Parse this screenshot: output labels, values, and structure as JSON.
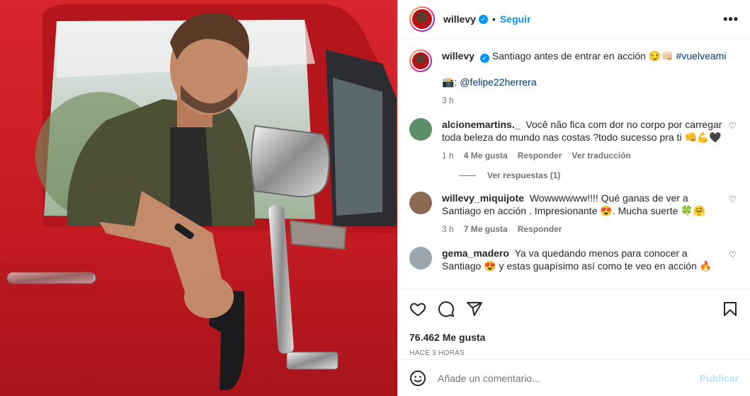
{
  "post": {
    "image_alt": "Hombre en una camioneta roja con pistola",
    "author": "willevy",
    "follow_label": "Seguir",
    "dot": "•"
  },
  "caption": {
    "author": "willevy",
    "text": "Santiago antes de entrar en acción 😏👊🏻",
    "hashtag": "#vuelveami",
    "credit_emoji": "📸:",
    "credit_mention": "@felipe22herrera",
    "time": "3 h"
  },
  "comments": [
    {
      "username": "alcionemartins._",
      "text": "Você não fica com dor no corpo por carregar toda beleza do mundo nas costas ?todo sucesso pra ti 👊💪🖤",
      "time": "1 h",
      "likes": "4 Me gusta",
      "reply": "Responder",
      "translate": "Ver traducción",
      "avatar_color": "#5d8f6b"
    },
    {
      "username": "willevy_miquijote",
      "text": "Wowwwwww!!!! Qué ganas de ver a Santiago en acción . Impresionante 😍. Mucha suerte 🍀🤗",
      "time": "3 h",
      "likes": "7 Me gusta",
      "reply": "Responder",
      "avatar_color": "#8a6b52"
    },
    {
      "username": "gema_madero",
      "text": "Ya va quedando menos para conocer a Santiago 😍 y estas guapísimo así como te veo en acción 🔥",
      "avatar_color": "#9aa6b0"
    }
  ],
  "view_replies": "Ver respuestas (1)",
  "stats": {
    "likes": "76.462 Me gusta",
    "when": "HACE 3 HORAS"
  },
  "composer": {
    "placeholder": "Añade un comentario...",
    "publish": "Publicar"
  },
  "icons": {
    "like": "heart-icon",
    "comment": "comment-icon",
    "share": "share-icon",
    "save": "bookmark-icon",
    "more": "more-options-icon",
    "emoji": "emoji-icon"
  },
  "colors": {
    "accent": "#0095f6",
    "truck_red": "#c81e24",
    "muted": "#737373"
  }
}
